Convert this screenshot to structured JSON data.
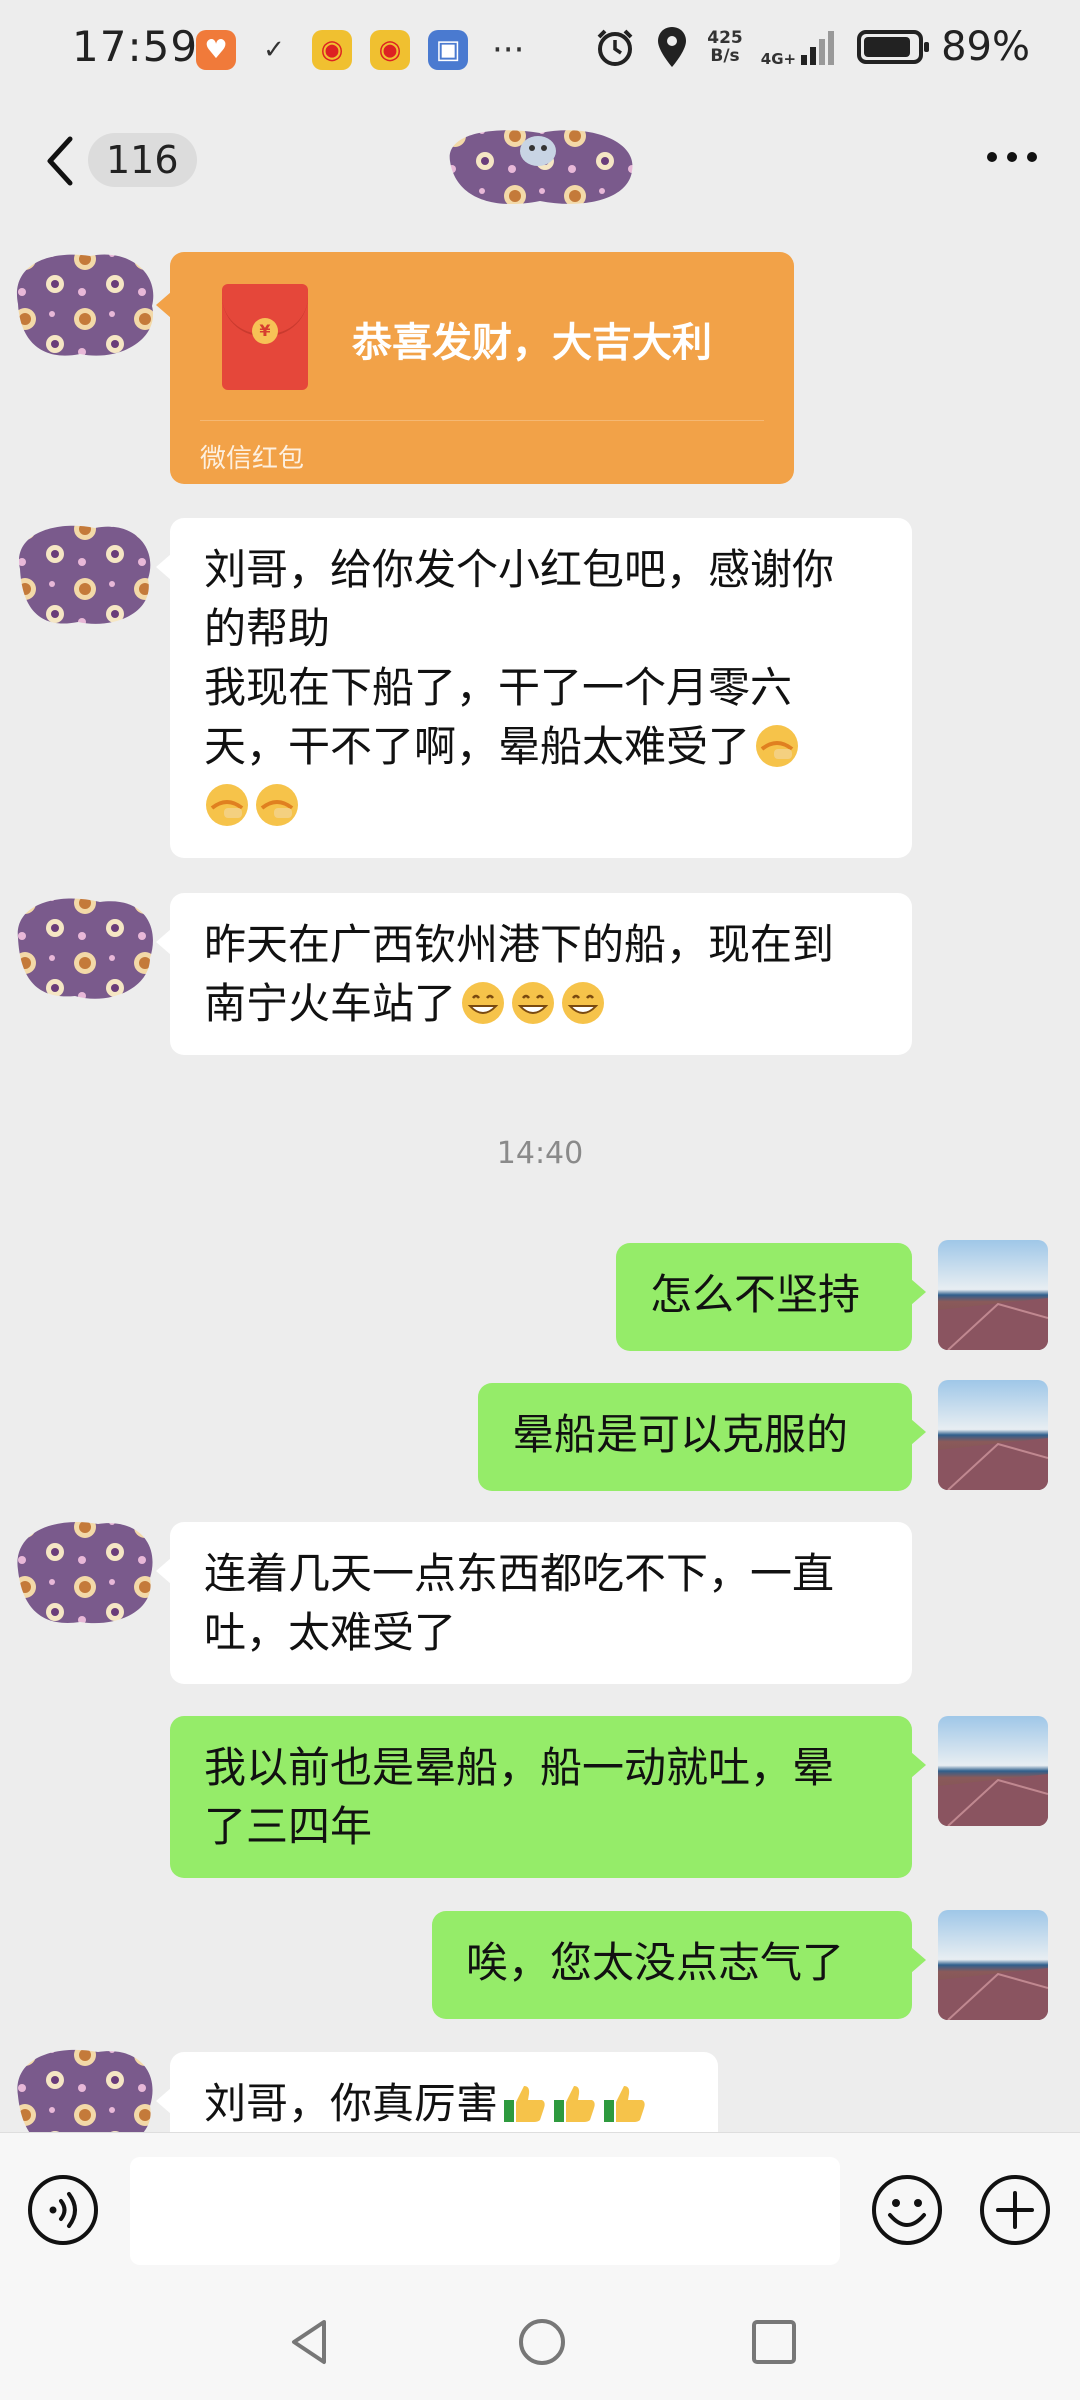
{
  "status_bar": {
    "time": "17:59",
    "net_speed_value": "425",
    "net_speed_unit": "B/s",
    "network": "4G+",
    "battery": "89%",
    "battery_level": 0.89,
    "notification_icons": [
      "shield-app-icon",
      "link-app-icon",
      "weibo-icon",
      "weibo-icon",
      "blue-app-icon"
    ],
    "more": "···"
  },
  "header": {
    "unread_count": "116",
    "title_icon": "avatar-sticker-image"
  },
  "messages": {
    "red_packet": {
      "text": "恭喜发财，大吉大利",
      "footer": "微信红包",
      "coin": "¥"
    },
    "m1": {
      "line1": "刘哥，给你发个小红包吧，感谢你",
      "line2": "的帮助",
      "line3": "我现在下船了，干了一个月零六",
      "line4": "天，干不了啊，晕船太难受了"
    },
    "m2": {
      "line1": "昨天在广西钦州港下的船，现在到",
      "line2": "南宁火车站了"
    },
    "timestamp": "14:40",
    "m3": {
      "text": "怎么不坚持"
    },
    "m4": {
      "text": "晕船是可以克服的"
    },
    "m5": {
      "line1": "连着几天一点东西都吃不下，一直",
      "line2": "吐，太难受了"
    },
    "m6": {
      "line1": "我以前也是晕船，船一动就吐，晕",
      "line2": "了三四年"
    },
    "m7": {
      "text": "唉，您太没点志气了"
    },
    "m8": {
      "text": "刘哥，你真厉害"
    }
  },
  "input": {
    "value": "",
    "placeholder": ""
  },
  "colors": {
    "chat_bg": "#ededed",
    "green_bubble": "#95ec69",
    "red_packet": "#f2a248"
  }
}
